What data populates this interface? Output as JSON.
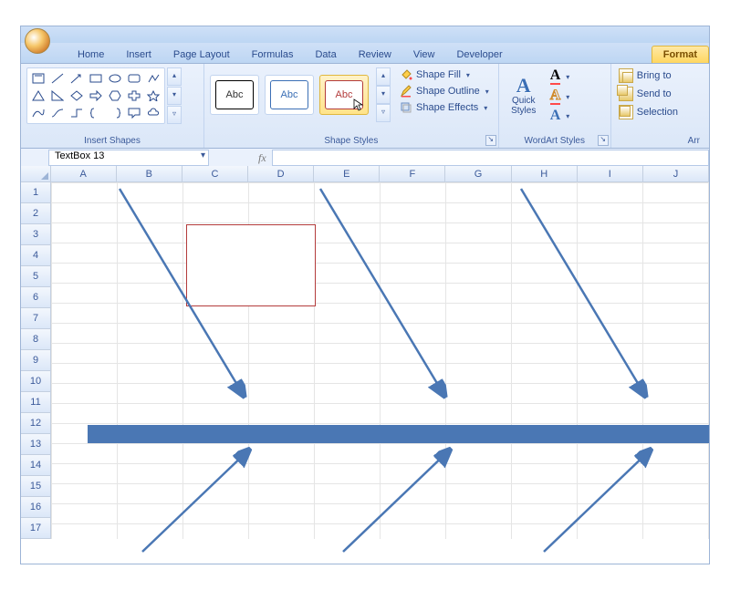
{
  "tabs": {
    "home": "Home",
    "insert": "Insert",
    "page_layout": "Page Layout",
    "formulas": "Formulas",
    "data": "Data",
    "review": "Review",
    "view": "View",
    "developer": "Developer",
    "format": "Format"
  },
  "ribbon": {
    "insert_shapes_label": "Insert Shapes",
    "shape_styles_label": "Shape Styles",
    "wordart_styles_label": "WordArt Styles",
    "arrange_label": "Arr",
    "style_sample": "Abc",
    "shape_fill": "Shape Fill",
    "shape_outline": "Shape Outline",
    "shape_effects": "Shape Effects",
    "quick_styles": "Quick\nStyles",
    "bring_to": "Bring to",
    "send_to": "Send to",
    "selection": "Selection",
    "bigA1": "A",
    "bigA2": "A",
    "bigA3": "A"
  },
  "fxbar": {
    "name_box": "TextBox 13",
    "fx_label": "fx",
    "formula": ""
  },
  "grid": {
    "columns": [
      "A",
      "B",
      "C",
      "D",
      "E",
      "F",
      "G",
      "H",
      "I",
      "J"
    ],
    "rows": [
      "1",
      "2",
      "3",
      "4",
      "5",
      "6",
      "7",
      "8",
      "9",
      "10",
      "11",
      "12",
      "13",
      "14",
      "15",
      "16",
      "17"
    ]
  },
  "dropdown_caret": "▾"
}
